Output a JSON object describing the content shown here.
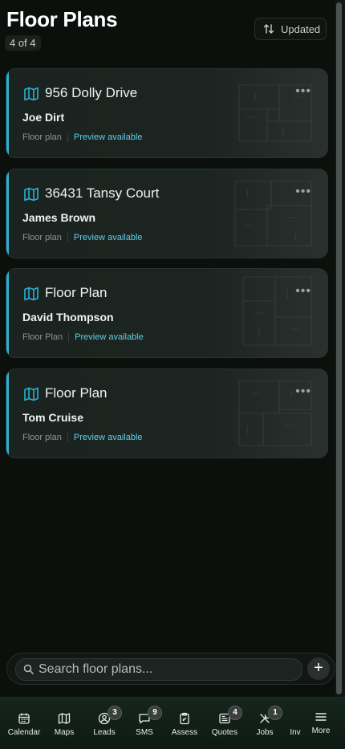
{
  "header": {
    "title": "Floor Plans",
    "count": "4 of 4",
    "sort_label": "Updated"
  },
  "plans": [
    {
      "name": "956 Dolly Drive",
      "client": "Joe Dirt",
      "type": "Floor plan",
      "preview": "Preview available"
    },
    {
      "name": "36431 Tansy Court",
      "client": "James Brown",
      "type": "Floor plan",
      "preview": "Preview available"
    },
    {
      "name": "Floor Plan",
      "client": "David Thompson",
      "type": "Floor Plan",
      "preview": "Preview available"
    },
    {
      "name": "Floor Plan",
      "client": "Tom Cruise",
      "type": "Floor plan",
      "preview": "Preview available"
    }
  ],
  "search": {
    "placeholder": "Search floor plans..."
  },
  "tabs": [
    {
      "label": "Calendar",
      "icon": "calendar-icon"
    },
    {
      "label": "Maps",
      "icon": "map-icon"
    },
    {
      "label": "Leads",
      "icon": "user-circle-icon",
      "badge": "3"
    },
    {
      "label": "SMS",
      "icon": "chat-icon",
      "badge": "9"
    },
    {
      "label": "Assess",
      "icon": "clipboard-icon"
    },
    {
      "label": "Quotes",
      "icon": "invoice-icon",
      "badge": "4"
    },
    {
      "label": "Jobs",
      "icon": "tools-icon",
      "badge": "1"
    },
    {
      "label": "Inv",
      "icon": ""
    },
    {
      "label": "More",
      "icon": "menu-icon"
    }
  ],
  "colors": {
    "accent": "#2bb1d4",
    "preview_link": "#5fcfe6",
    "background": "#0b100d"
  }
}
